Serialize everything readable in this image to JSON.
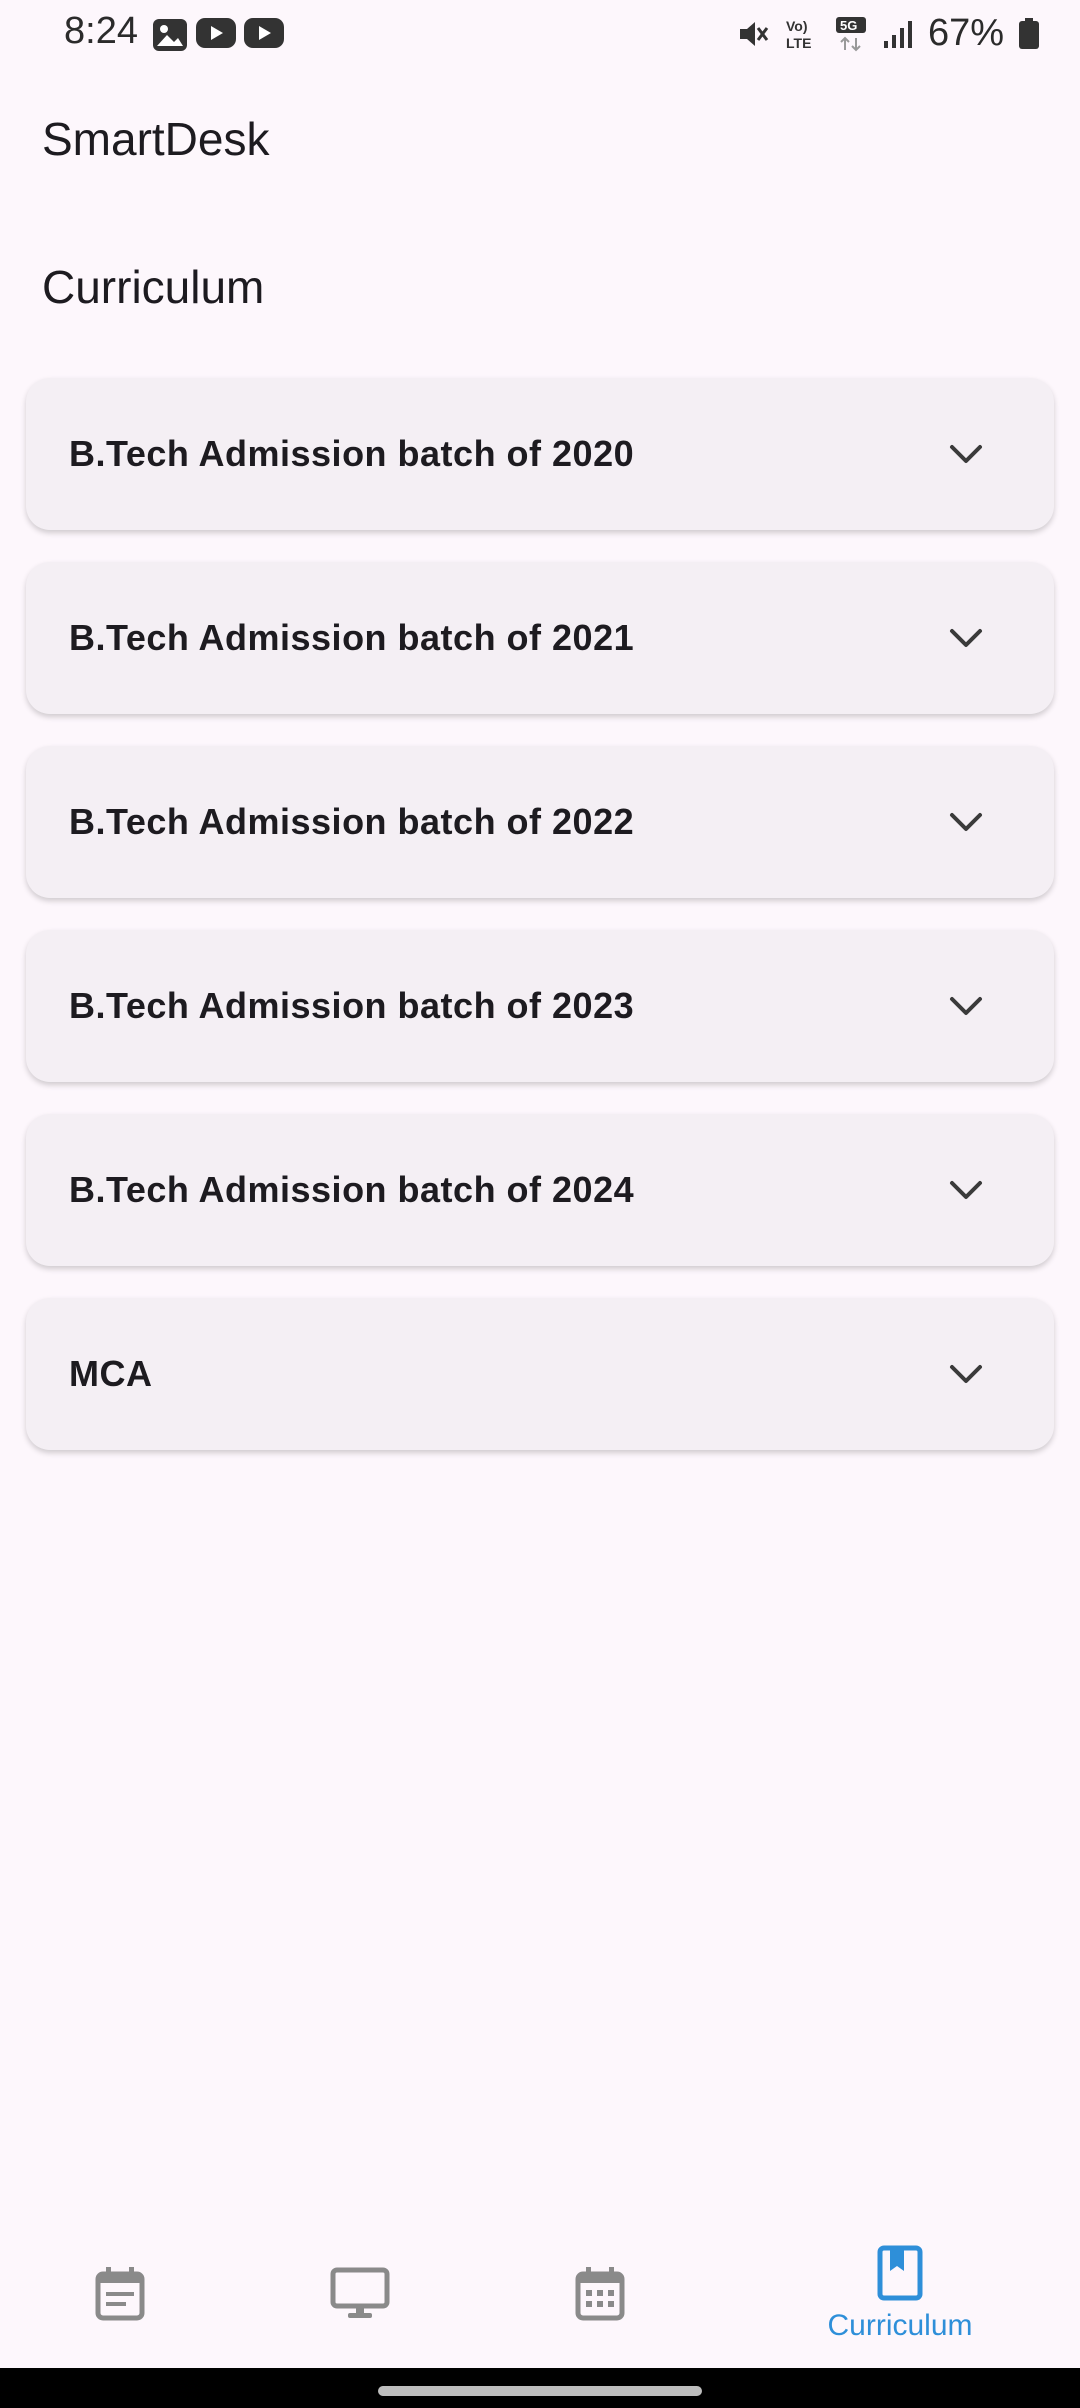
{
  "status_bar": {
    "time": "8:24",
    "left_icons": [
      "image-icon",
      "youtube-icon",
      "youtube-icon"
    ],
    "right_icons": [
      "mute-icon",
      "volte-icon",
      "5g-icon",
      "signal-icon"
    ],
    "battery": "67%"
  },
  "app": {
    "title": "SmartDesk"
  },
  "page": {
    "title": "Curriculum"
  },
  "accordion": {
    "items": [
      {
        "label": "B.Tech Admission batch of 2020"
      },
      {
        "label": "B.Tech Admission batch of 2021"
      },
      {
        "label": "B.Tech Admission batch of 2022"
      },
      {
        "label": "B.Tech Admission batch of 2023"
      },
      {
        "label": "B.Tech Admission batch of 2024"
      },
      {
        "label": "MCA"
      }
    ]
  },
  "bottom_nav": {
    "items": [
      {
        "icon": "event-note-icon",
        "label": ""
      },
      {
        "icon": "desktop-icon",
        "label": ""
      },
      {
        "icon": "calendar-icon",
        "label": ""
      },
      {
        "icon": "book-bookmark-icon",
        "label": "Curriculum",
        "active": true
      }
    ],
    "active_color": "#2e8fd9",
    "inactive_color": "#8a8a8a"
  }
}
